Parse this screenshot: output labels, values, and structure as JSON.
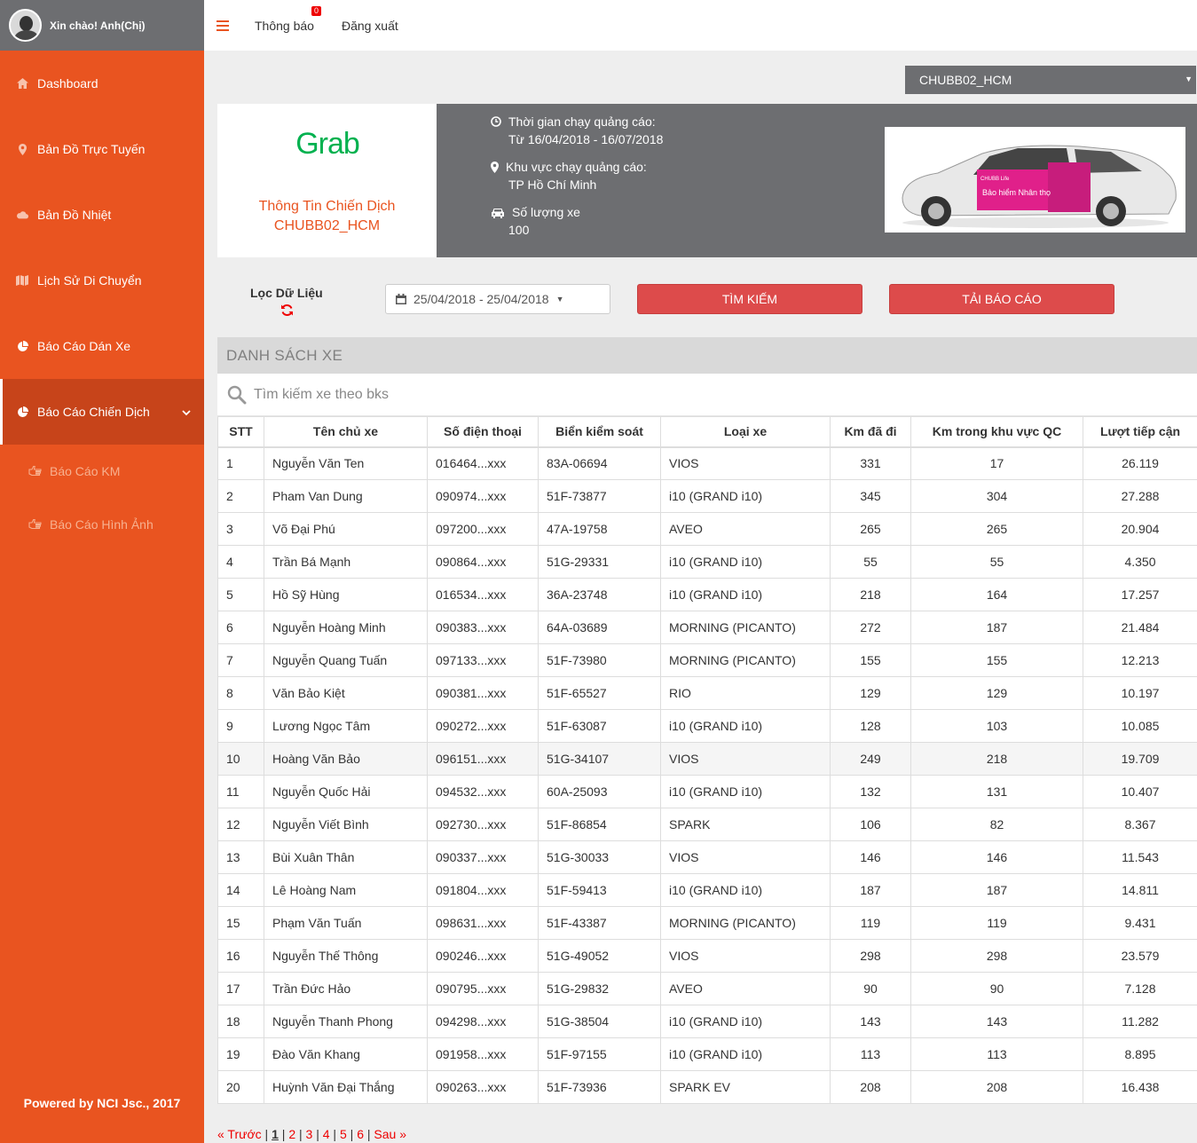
{
  "sidebar": {
    "greeting": "Xin chào! Anh(Chị)",
    "items": [
      {
        "label": "Dashboard",
        "icon": "home-icon"
      },
      {
        "label": "Bản Đồ Trực Tuyến",
        "icon": "map-marker-icon"
      },
      {
        "label": "Bản Đồ Nhiệt",
        "icon": "cloud-icon"
      },
      {
        "label": "Lịch Sử Di Chuyển",
        "icon": "map-icon"
      },
      {
        "label": "Báo Cáo Dán Xe",
        "icon": "pie-chart-icon"
      },
      {
        "label": "Báo Cáo Chiến Dịch",
        "icon": "pie-chart-icon",
        "active": true
      }
    ],
    "subitems": [
      {
        "label": "Báo Cáo KM",
        "icon": "hand-pointer-icon"
      },
      {
        "label": "Báo Cáo Hình Ảnh",
        "icon": "hand-pointer-icon"
      }
    ],
    "footer": "Powered by NCI Jsc., 2017"
  },
  "topbar": {
    "notifications_label": "Thông báo",
    "notifications_count": "0",
    "logout_label": "Đăng xuất"
  },
  "campaign_select": {
    "value": "CHUBB02_HCM"
  },
  "info": {
    "logo_text": "Grab",
    "title_line1": "Thông Tin Chiến Dịch",
    "title_line2": "CHUBB02_HCM",
    "time_label": "Thời gian chạy quảng cáo:",
    "time_value": "Từ 16/04/2018 - 16/07/2018",
    "area_label": "Khu vực chạy quảng cáo:",
    "area_value": "TP Hồ Chí Minh",
    "cars_label": "Số lượng xe",
    "cars_value": "100",
    "ad_text": "Bảo hiểm Nhân thọ",
    "ad_brand": "CHUBB Life"
  },
  "filter": {
    "label": "Lọc Dữ Liệu",
    "date_range": "25/04/2018 - 25/04/2018",
    "search_button": "TÌM KIẾM",
    "report_button": "TẢI BÁO CÁO"
  },
  "list": {
    "header": "DANH SÁCH XE",
    "search_placeholder": "Tìm kiếm xe theo bks",
    "columns": [
      "STT",
      "Tên chủ xe",
      "Số điện thoại",
      "Biển kiểm soát",
      "Loại xe",
      "Km đã đi",
      "Km trong khu vực QC",
      "Lượt tiếp cận"
    ],
    "rows": [
      [
        "1",
        "Nguyễn Văn Ten",
        "016464...xxx",
        "83A-06694",
        "VIOS",
        "331",
        "17",
        "26.119"
      ],
      [
        "2",
        "Pham Van Dung",
        "090974...xxx",
        "51F-73877",
        "i10 (GRAND i10)",
        "345",
        "304",
        "27.288"
      ],
      [
        "3",
        "Võ Đại Phú",
        "097200...xxx",
        "47A-19758",
        "AVEO",
        "265",
        "265",
        "20.904"
      ],
      [
        "4",
        "Trần Bá Mạnh",
        "090864...xxx",
        "51G-29331",
        "i10 (GRAND i10)",
        "55",
        "55",
        "4.350"
      ],
      [
        "5",
        "Hồ Sỹ Hùng",
        "016534...xxx",
        "36A-23748",
        "i10 (GRAND i10)",
        "218",
        "164",
        "17.257"
      ],
      [
        "6",
        "Nguyễn Hoàng Minh",
        "090383...xxx",
        "64A-03689",
        "MORNING (PICANTO)",
        "272",
        "187",
        "21.484"
      ],
      [
        "7",
        "Nguyễn Quang Tuấn",
        "097133...xxx",
        "51F-73980",
        "MORNING (PICANTO)",
        "155",
        "155",
        "12.213"
      ],
      [
        "8",
        "Văn Bảo Kiệt",
        "090381...xxx",
        "51F-65527",
        "RIO",
        "129",
        "129",
        "10.197"
      ],
      [
        "9",
        "Lương Ngọc Tâm",
        "090272...xxx",
        "51F-63087",
        "i10 (GRAND i10)",
        "128",
        "103",
        "10.085"
      ],
      [
        "10",
        "Hoàng Văn Bảo",
        "096151...xxx",
        "51G-34107",
        "VIOS",
        "249",
        "218",
        "19.709"
      ],
      [
        "11",
        "Nguyễn Quốc Hải",
        "094532...xxx",
        "60A-25093",
        "i10 (GRAND i10)",
        "132",
        "131",
        "10.407"
      ],
      [
        "12",
        "Nguyễn Viết Bình",
        "092730...xxx",
        "51F-86854",
        "SPARK",
        "106",
        "82",
        "8.367"
      ],
      [
        "13",
        "Bùi Xuân Thân",
        "090337...xxx",
        "51G-30033",
        "VIOS",
        "146",
        "146",
        "11.543"
      ],
      [
        "14",
        "Lê Hoàng Nam",
        "091804...xxx",
        "51F-59413",
        "i10 (GRAND i10)",
        "187",
        "187",
        "14.811"
      ],
      [
        "15",
        "Phạm Văn Tuấn",
        "098631...xxx",
        "51F-43387",
        "MORNING (PICANTO)",
        "119",
        "119",
        "9.431"
      ],
      [
        "16",
        "Nguyễn Thế Thông",
        "090246...xxx",
        "51G-49052",
        "VIOS",
        "298",
        "298",
        "23.579"
      ],
      [
        "17",
        "Trần Đức Hảo",
        "090795...xxx",
        "51G-29832",
        "AVEO",
        "90",
        "90",
        "7.128"
      ],
      [
        "18",
        "Nguyễn Thanh Phong",
        "094298...xxx",
        "51G-38504",
        "i10 (GRAND i10)",
        "143",
        "143",
        "11.282"
      ],
      [
        "19",
        "Đào Văn Khang",
        "091958...xxx",
        "51F-97155",
        "i10 (GRAND i10)",
        "113",
        "113",
        "8.895"
      ],
      [
        "20",
        "Huỳnh Văn Đại Thắng",
        "090263...xxx",
        "51F-73936",
        "SPARK EV",
        "208",
        "208",
        "16.438"
      ]
    ],
    "highlight_row": 10
  },
  "pagination": {
    "prev": "« Trước",
    "pages": [
      "1",
      "2",
      "3",
      "4",
      "5",
      "6"
    ],
    "current": "1",
    "next": "Sau »"
  },
  "colors": {
    "accent": "#e95420",
    "sidebar_active": "#c7441a",
    "panel_gray": "#6d6e71",
    "button_red": "#dd4b4b",
    "grab_green": "#00b14f"
  }
}
